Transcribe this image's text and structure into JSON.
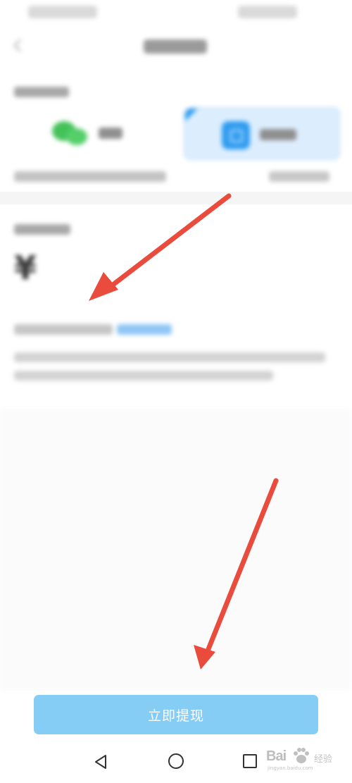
{
  "withdraw_button": {
    "label": "立即提现"
  },
  "amount": {
    "currency_symbol": "¥"
  },
  "watermark": {
    "text": "Bai",
    "text2": "经验",
    "url": "jingyan.baidu.com"
  },
  "colors": {
    "accent_blue": "#2f9cf0",
    "button_blue": "#86cdf6",
    "arrow_red": "#e94b3c",
    "wechat_green": "#44c25a",
    "selected_card_bg": "#dceefe"
  },
  "icons": {
    "back": "chevron-left-icon",
    "wechat": "wechat-icon",
    "alipay": "alipay-icon",
    "nav_back": "triangle-back-icon",
    "nav_home": "circle-home-icon",
    "nav_recent": "square-recent-icon"
  },
  "annotations": {
    "arrow_count": 2,
    "arrow_color": "#e94b3c"
  }
}
